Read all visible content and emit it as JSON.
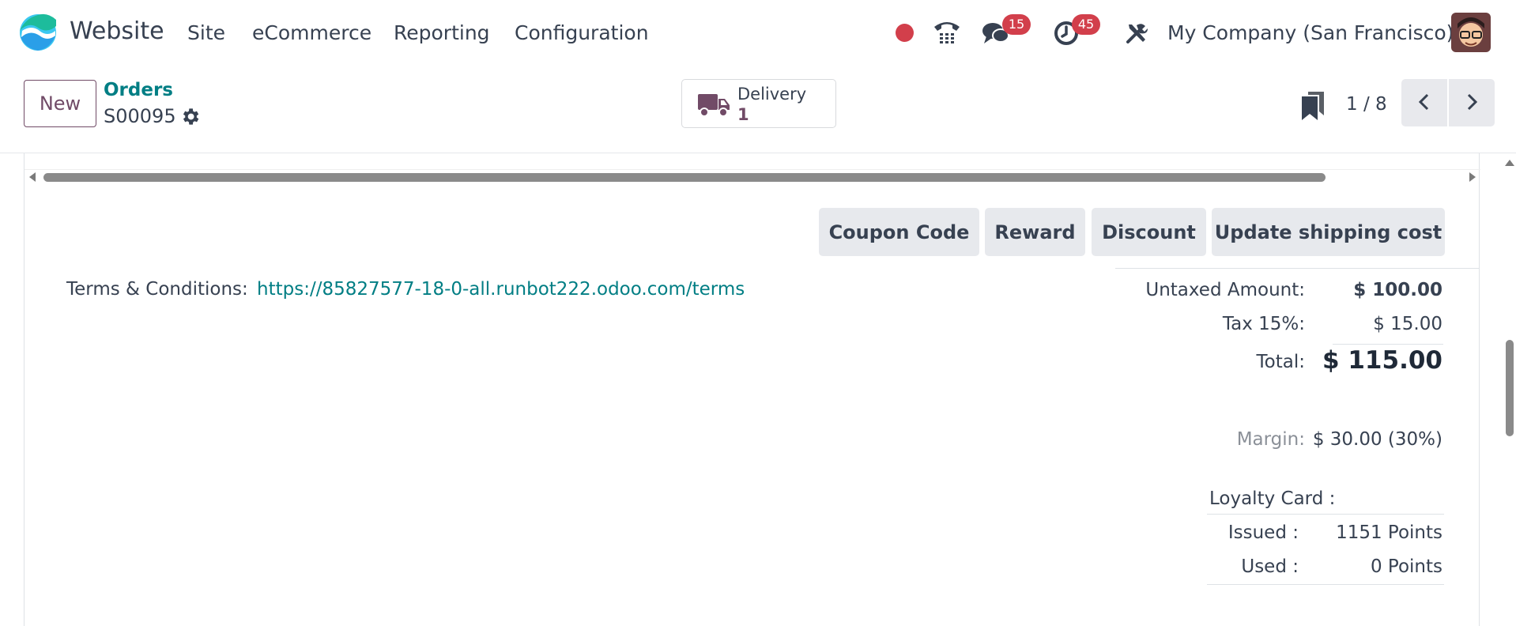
{
  "navbar": {
    "app_name": "Website",
    "menu": [
      "Site",
      "eCommerce",
      "Reporting",
      "Configuration"
    ],
    "icons": {
      "logo": "odoo-website-logo",
      "recording": "red-dot-icon",
      "phone": "phone-icon",
      "messages": "chat-bubble-icon",
      "activities": "clock-icon",
      "debug": "tools-icon"
    },
    "messages_badge": "15",
    "activities_badge": "45",
    "company": "My Company (San Francisco)"
  },
  "control_panel": {
    "new_label": "New",
    "breadcrumb_parent": "Orders",
    "breadcrumb_current": "S00095",
    "smart_button": {
      "label": "Delivery",
      "value": "1",
      "icon": "truck-icon"
    },
    "pager": "1 / 8"
  },
  "actions": {
    "coupon": "Coupon Code",
    "reward": "Reward",
    "discount": "Discount",
    "shipping": "Update shipping cost"
  },
  "terms": {
    "label": "Terms & Conditions:",
    "link": "https://85827577-18-0-all.runbot222.odoo.com/terms"
  },
  "totals": {
    "untaxed_label": "Untaxed Amount:",
    "untaxed_value": "$ 100.00",
    "tax_label": "Tax 15%:",
    "tax_value": "$ 15.00",
    "total_label": "Total:",
    "total_value": "$ 115.00",
    "margin_label": "Margin:",
    "margin_value": "$ 30.00 (30%)"
  },
  "loyalty": {
    "title": "Loyalty Card :",
    "issued_label": "Issued :",
    "issued_value": "1151 Points",
    "used_label": "Used :",
    "used_value": "0 Points"
  },
  "colors": {
    "brand": "#714b67",
    "link": "#017e84",
    "badge": "#d23f4b",
    "button_bg": "#e7e9ed"
  }
}
